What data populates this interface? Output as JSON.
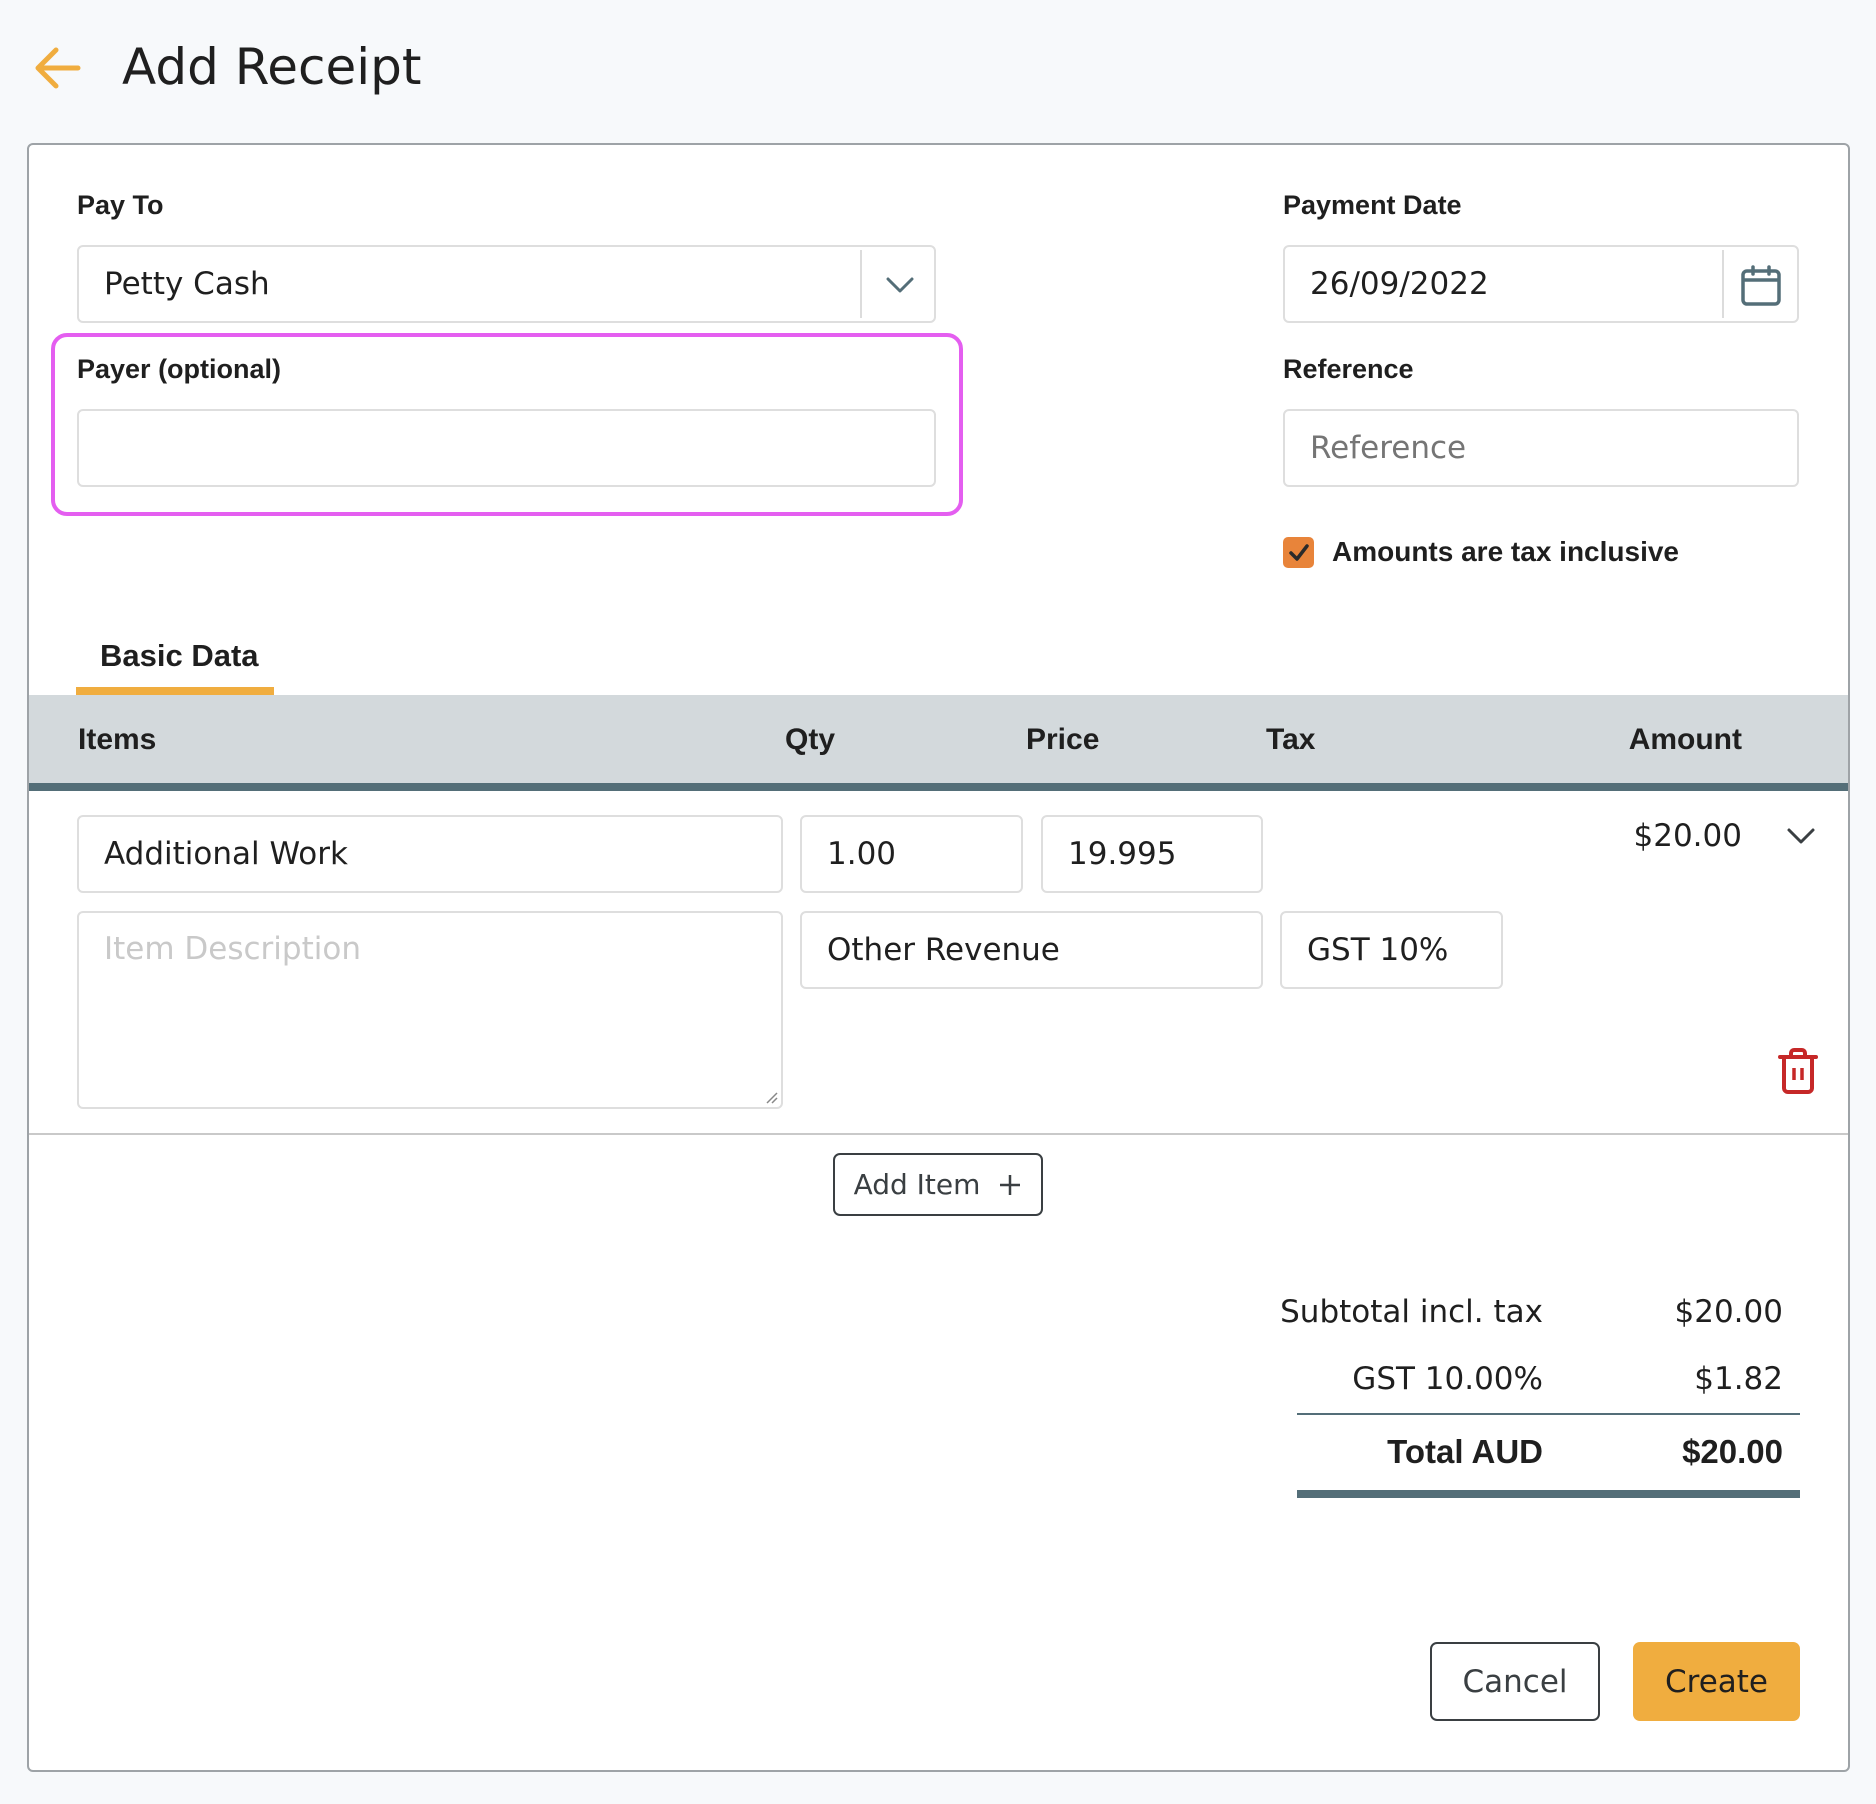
{
  "header": {
    "back_icon": "arrow-left-icon",
    "title": "Add Receipt",
    "accent_color": "#f0ad3f"
  },
  "form": {
    "pay_to": {
      "label": "Pay To",
      "value": "Petty Cash",
      "icon": "chevron-down-icon"
    },
    "payer": {
      "label": "Payer (optional)",
      "value": "",
      "placeholder": "",
      "highlight_color": "#e45ef0"
    },
    "payment_date": {
      "label": "Payment Date",
      "value": "26/09/2022",
      "icon": "calendar-icon"
    },
    "reference": {
      "label": "Reference",
      "value": "",
      "placeholder": "Reference"
    },
    "tax_inclusive": {
      "label": "Amounts are tax inclusive",
      "checked": true,
      "color": "#e8843a"
    }
  },
  "tabs": [
    {
      "label": "Basic Data",
      "active": true
    }
  ],
  "table": {
    "columns": [
      "Items",
      "Qty",
      "Price",
      "Tax",
      "Amount"
    ],
    "rows": [
      {
        "item": "Additional Work",
        "qty": "1.00",
        "price": "19.995",
        "amount": "$20.00",
        "description": "",
        "description_placeholder": "Item Description",
        "account": "Other Revenue",
        "tax_rate": "GST 10%",
        "expand_icon": "chevron-down-icon",
        "delete_icon": "trash-icon",
        "delete_color": "#c62828"
      }
    ],
    "add_item_label": "Add Item",
    "add_item_icon": "plus-icon"
  },
  "totals": [
    {
      "label": "Subtotal incl. tax",
      "value": "$20.00"
    },
    {
      "label": "GST 10.00%",
      "value": "$1.82"
    },
    {
      "label": "Total AUD",
      "value": "$20.00",
      "bold": true
    }
  ],
  "actions": {
    "cancel_label": "Cancel",
    "create_label": "Create"
  }
}
